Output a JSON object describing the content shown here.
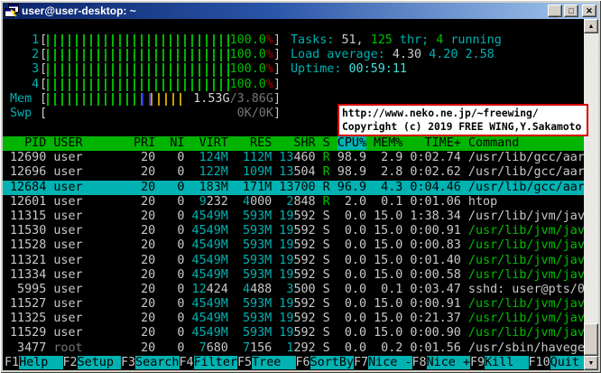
{
  "palette": {
    "green": "#00c000",
    "green_bg": "#00b400",
    "bar_green": "#00b400",
    "cyan": "#00b2b2",
    "cyan_bright": "#40e0e0",
    "white": "#c9c9c9",
    "white2": "#d6d6d6",
    "dim": "#767676",
    "red": "#b40000",
    "blue": "#3333cc",
    "yellow": "#c2a000"
  },
  "window": {
    "title": "user@user-desktop: ~"
  },
  "icons": {
    "minimize": "_",
    "maximize": "□",
    "close": "✕",
    "scroll_up": "▲",
    "scroll_down": "▼"
  },
  "meters": {
    "cpu_rows": [
      {
        "label": "1",
        "value": "100.0",
        "suffix": "%"
      },
      {
        "label": "2",
        "value": "100.0",
        "suffix": "%"
      },
      {
        "label": "3",
        "value": "100.0",
        "suffix": "%"
      },
      {
        "label": "4",
        "value": "100.0",
        "suffix": "%"
      }
    ],
    "mem": {
      "label": "Mem",
      "used": "1.53G",
      "total": "/3.86G",
      "segments": [
        {
          "color": "bar_green",
          "pct": 42
        },
        {
          "color": "blue",
          "pct": 4
        },
        {
          "color": "yellow",
          "pct": 15
        }
      ]
    },
    "swp": {
      "label": "Swp",
      "value": "0K/0K"
    }
  },
  "summary": {
    "tasks": [
      {
        "t": "Tasks: ",
        "c": "c"
      },
      {
        "t": "51, ",
        "c": "w"
      },
      {
        "t": "125",
        "c": "g"
      },
      {
        "t": " thr; ",
        "c": "c"
      },
      {
        "t": "4",
        "c": "g"
      },
      {
        "t": " running",
        "c": "c"
      }
    ],
    "load": [
      {
        "t": "Load average: ",
        "c": "c"
      },
      {
        "t": "4.30 ",
        "c": "w"
      },
      {
        "t": "4.20 ",
        "c": "c"
      },
      {
        "t": "2.58",
        "c": "c"
      }
    ],
    "uptime": [
      {
        "t": "Uptime: ",
        "c": "c"
      },
      {
        "t": "00:59:11",
        "c": "cb"
      }
    ]
  },
  "overlay": {
    "line1": "http://www.neko.ne.jp/~freewing/",
    "line2": "Copyright (c) 2019 FREE WING,Y.Sakamoto",
    "border_color": "#d40000"
  },
  "table": {
    "columns": [
      "PID",
      "USER",
      "PRI",
      "NI",
      "VIRT",
      "RES",
      "SHR",
      "S",
      "CPU%",
      "MEM%",
      "TIME+",
      "Command"
    ],
    "sort_column": "CPU%",
    "rows": [
      {
        "pid": "12690",
        "user": "user",
        "pri": "20",
        "ni": "0",
        "virt": [
          "124M",
          ""
        ],
        "res": [
          "112M",
          ""
        ],
        "shr": [
          "13",
          "460"
        ],
        "state": "R",
        "cpu": "98.9",
        "mem": "2.9",
        "time": "0:02.74",
        "cmd": "/usr/lib/gcc/aarc"
      },
      {
        "pid": "12696",
        "user": "user",
        "pri": "20",
        "ni": "0",
        "virt": [
          "122M",
          ""
        ],
        "res": [
          "109M",
          ""
        ],
        "shr": [
          "13",
          "504"
        ],
        "state": "R",
        "cpu": "98.9",
        "mem": "2.8",
        "time": "0:02.62",
        "cmd": "/usr/lib/gcc/aarc"
      },
      {
        "pid": "12684",
        "user": "user",
        "pri": "20",
        "ni": "0",
        "virt": [
          "183M",
          ""
        ],
        "res": [
          "171M",
          ""
        ],
        "shr": [
          "13",
          "700"
        ],
        "state": "R",
        "cpu": "96.9",
        "mem": "4.3",
        "time": "0:04.46",
        "cmd": "/usr/lib/gcc/aarc",
        "selected": true
      },
      {
        "pid": "12601",
        "user": "user",
        "pri": "20",
        "ni": "0",
        "virt": [
          "9",
          "232"
        ],
        "res": [
          "4",
          "000"
        ],
        "shr": [
          "2",
          "848"
        ],
        "state": "R",
        "cpu": "2.0",
        "mem": "0.1",
        "time": "0:01.06",
        "cmd": "htop"
      },
      {
        "pid": "11315",
        "user": "user",
        "pri": "20",
        "ni": "0",
        "virt": [
          "4549M",
          ""
        ],
        "res": [
          "593M",
          ""
        ],
        "shr": [
          "19",
          "592"
        ],
        "state": "S",
        "cpu": "0.0",
        "mem": "15.0",
        "time": "1:38.34",
        "cmd": "/usr/lib/jvm/java"
      },
      {
        "pid": "11530",
        "user": "user",
        "pri": "20",
        "ni": "0",
        "virt": [
          "4549M",
          ""
        ],
        "res": [
          "593M",
          ""
        ],
        "shr": [
          "19",
          "592"
        ],
        "state": "S",
        "cpu": "0.0",
        "mem": "15.0",
        "time": "0:00.91",
        "cmd": "/usr/lib/jvm/java",
        "cmd_green": true
      },
      {
        "pid": "11528",
        "user": "user",
        "pri": "20",
        "ni": "0",
        "virt": [
          "4549M",
          ""
        ],
        "res": [
          "593M",
          ""
        ],
        "shr": [
          "19",
          "592"
        ],
        "state": "S",
        "cpu": "0.0",
        "mem": "15.0",
        "time": "0:00.83",
        "cmd": "/usr/lib/jvm/java",
        "cmd_green": true
      },
      {
        "pid": "11321",
        "user": "user",
        "pri": "20",
        "ni": "0",
        "virt": [
          "4549M",
          ""
        ],
        "res": [
          "593M",
          ""
        ],
        "shr": [
          "19",
          "592"
        ],
        "state": "S",
        "cpu": "0.0",
        "mem": "15.0",
        "time": "0:01.40",
        "cmd": "/usr/lib/jvm/java",
        "cmd_green": true
      },
      {
        "pid": "11334",
        "user": "user",
        "pri": "20",
        "ni": "0",
        "virt": [
          "4549M",
          ""
        ],
        "res": [
          "593M",
          ""
        ],
        "shr": [
          "19",
          "592"
        ],
        "state": "S",
        "cpu": "0.0",
        "mem": "15.0",
        "time": "0:00.58",
        "cmd": "/usr/lib/jvm/java",
        "cmd_green": true
      },
      {
        "pid": "5995",
        "user": "user",
        "pri": "20",
        "ni": "0",
        "virt": [
          "12",
          "424"
        ],
        "res": [
          "4",
          "488"
        ],
        "shr": [
          "3",
          "500"
        ],
        "state": "S",
        "cpu": "0.0",
        "mem": "0.1",
        "time": "0:03.47",
        "cmd": "sshd: user@pts/0"
      },
      {
        "pid": "11527",
        "user": "user",
        "pri": "20",
        "ni": "0",
        "virt": [
          "4549M",
          ""
        ],
        "res": [
          "593M",
          ""
        ],
        "shr": [
          "19",
          "592"
        ],
        "state": "S",
        "cpu": "0.0",
        "mem": "15.0",
        "time": "0:00.91",
        "cmd": "/usr/lib/jvm/java",
        "cmd_green": true
      },
      {
        "pid": "11325",
        "user": "user",
        "pri": "20",
        "ni": "0",
        "virt": [
          "4549M",
          ""
        ],
        "res": [
          "593M",
          ""
        ],
        "shr": [
          "19",
          "592"
        ],
        "state": "S",
        "cpu": "0.0",
        "mem": "15.0",
        "time": "0:21.37",
        "cmd": "/usr/lib/jvm/java",
        "cmd_green": true
      },
      {
        "pid": "11529",
        "user": "user",
        "pri": "20",
        "ni": "0",
        "virt": [
          "4549M",
          ""
        ],
        "res": [
          "593M",
          ""
        ],
        "shr": [
          "19",
          "592"
        ],
        "state": "S",
        "cpu": "0.0",
        "mem": "15.0",
        "time": "0:00.90",
        "cmd": "/usr/lib/jvm/java",
        "cmd_green": true
      },
      {
        "pid": "3477",
        "user": "root",
        "user_dim": true,
        "pri": "20",
        "ni": "0",
        "virt": [
          "7",
          "680"
        ],
        "res": [
          "7",
          "156"
        ],
        "shr": [
          "1",
          "292"
        ],
        "state": "S",
        "cpu": "0.0",
        "mem": "0.2",
        "time": "0:01.56",
        "cmd": "/usr/sbin/haveged"
      }
    ]
  },
  "fkeys": [
    {
      "key": "F1",
      "label": "Help"
    },
    {
      "key": "F2",
      "label": "Setup"
    },
    {
      "key": "F3",
      "label": "Search"
    },
    {
      "key": "F4",
      "label": "Filter"
    },
    {
      "key": "F5",
      "label": "Tree"
    },
    {
      "key": "F6",
      "label": "SortBy"
    },
    {
      "key": "F7",
      "label": "Nice -"
    },
    {
      "key": "F8",
      "label": "Nice +"
    },
    {
      "key": "F9",
      "label": "Kill"
    },
    {
      "key": "F10",
      "label": "Quit"
    }
  ]
}
